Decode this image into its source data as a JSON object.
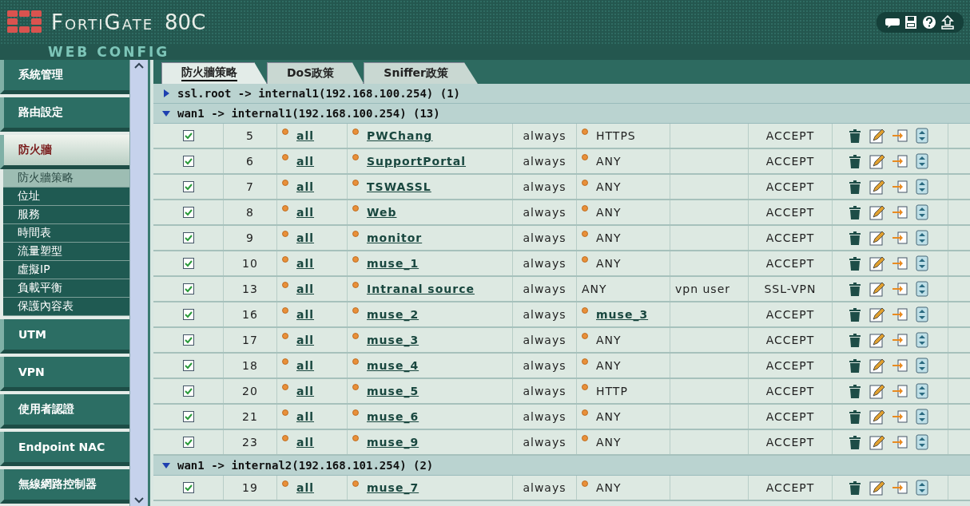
{
  "header": {
    "brand": "FortiGate",
    "model": "80C",
    "subtitle": "WEB CONFIG"
  },
  "sidebar": {
    "items": [
      {
        "label": "系統管理",
        "expanded": false
      },
      {
        "label": "路由設定",
        "expanded": false
      },
      {
        "label": "防火牆",
        "expanded": true,
        "children": [
          {
            "label": "防火牆策略",
            "selected": true
          },
          {
            "label": "位址",
            "selected": false
          },
          {
            "label": "服務",
            "selected": false
          },
          {
            "label": "時間表",
            "selected": false
          },
          {
            "label": "流量塑型",
            "selected": false
          },
          {
            "label": "虛擬IP",
            "selected": false
          },
          {
            "label": "負載平衡",
            "selected": false
          },
          {
            "label": "保護內容表",
            "selected": false
          }
        ]
      },
      {
        "label": "UTM",
        "expanded": false
      },
      {
        "label": "VPN",
        "expanded": false
      },
      {
        "label": "使用者認證",
        "expanded": false
      },
      {
        "label": "Endpoint NAC",
        "expanded": false
      },
      {
        "label": "無線網路控制器",
        "expanded": false
      }
    ]
  },
  "tabs": [
    {
      "label": "防火牆策略",
      "selected": true
    },
    {
      "label": "DoS政策",
      "selected": false
    },
    {
      "label": "Sniffer政策",
      "selected": false
    }
  ],
  "groups": [
    {
      "title": "ssl.root -> internal1(192.168.100.254) (1)",
      "expanded": false
    },
    {
      "title": "wan1 -> internal1(192.168.100.254) (13)",
      "expanded": true,
      "rows": [
        {
          "enabled": true,
          "id": "5",
          "source": "all",
          "destination": "PWChang",
          "schedule": "always",
          "service": "HTTPS",
          "service_dot": true,
          "service_link": false,
          "action": "ACCEPT"
        },
        {
          "enabled": true,
          "id": "6",
          "source": "all",
          "destination": "SupportPortal",
          "schedule": "always",
          "service": "ANY",
          "service_dot": true,
          "service_link": false,
          "action": "ACCEPT"
        },
        {
          "enabled": true,
          "id": "7",
          "source": "all",
          "destination": "TSWASSL",
          "schedule": "always",
          "service": "ANY",
          "service_dot": true,
          "service_link": false,
          "action": "ACCEPT"
        },
        {
          "enabled": true,
          "id": "8",
          "source": "all",
          "destination": "Web",
          "schedule": "always",
          "service": "ANY",
          "service_dot": true,
          "service_link": false,
          "action": "ACCEPT"
        },
        {
          "enabled": true,
          "id": "9",
          "source": "all",
          "destination": "monitor",
          "schedule": "always",
          "service": "ANY",
          "service_dot": true,
          "service_link": false,
          "action": "ACCEPT"
        },
        {
          "enabled": true,
          "id": "10",
          "source": "all",
          "destination": "muse_1",
          "schedule": "always",
          "service": "ANY",
          "service_dot": true,
          "service_link": false,
          "action": "ACCEPT"
        },
        {
          "enabled": true,
          "id": "13",
          "source": "all",
          "destination": "Intranal source",
          "schedule": "always",
          "service": "ANY",
          "service_dot": false,
          "service_link": false,
          "column_8": "vpn user",
          "action": "SSL-VPN"
        },
        {
          "enabled": true,
          "id": "16",
          "source": "all",
          "destination": "muse_2",
          "schedule": "always",
          "service": "muse_3",
          "service_dot": true,
          "service_link": true,
          "action": "ACCEPT"
        },
        {
          "enabled": true,
          "id": "17",
          "source": "all",
          "destination": "muse_3",
          "schedule": "always",
          "service": "ANY",
          "service_dot": true,
          "service_link": false,
          "action": "ACCEPT"
        },
        {
          "enabled": true,
          "id": "18",
          "source": "all",
          "destination": "muse_4",
          "schedule": "always",
          "service": "ANY",
          "service_dot": true,
          "service_link": false,
          "action": "ACCEPT"
        },
        {
          "enabled": true,
          "id": "20",
          "source": "all",
          "destination": "muse_5",
          "schedule": "always",
          "service": "HTTP",
          "service_dot": true,
          "service_link": false,
          "action": "ACCEPT"
        },
        {
          "enabled": true,
          "id": "21",
          "source": "all",
          "destination": "muse_6",
          "schedule": "always",
          "service": "ANY",
          "service_dot": true,
          "service_link": false,
          "action": "ACCEPT"
        },
        {
          "enabled": true,
          "id": "23",
          "source": "all",
          "destination": "muse_9",
          "schedule": "always",
          "service": "ANY",
          "service_dot": true,
          "service_link": false,
          "action": "ACCEPT"
        }
      ]
    },
    {
      "title": "wan1 -> internal2(192.168.101.254) (2)",
      "expanded": true,
      "rows": [
        {
          "enabled": true,
          "id": "19",
          "source": "all",
          "destination": "muse_7",
          "schedule": "always",
          "service": "ANY",
          "service_dot": true,
          "service_link": false,
          "action": "ACCEPT"
        }
      ]
    }
  ]
}
